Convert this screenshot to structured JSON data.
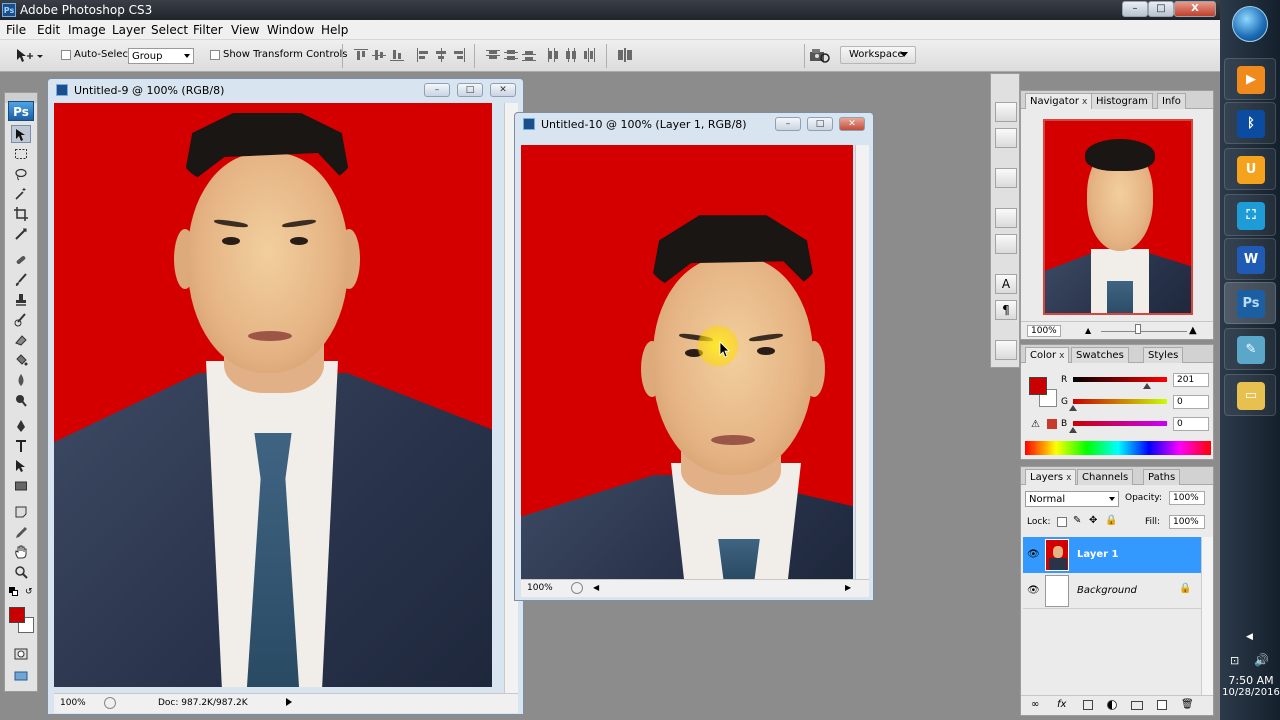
{
  "app": {
    "title": "Adobe Photoshop CS3",
    "ps_logo": "Ps",
    "window_controls": {
      "minimize": "–",
      "restore": "□",
      "close": "X"
    }
  },
  "menu": [
    "File",
    "Edit",
    "Image",
    "Layer",
    "Select",
    "Filter",
    "View",
    "Window",
    "Help"
  ],
  "options": {
    "auto_select_label": "Auto-Select:",
    "auto_select_value": "Group",
    "show_transform_label": "Show Transform Controls",
    "workspace_label": "Workspace"
  },
  "documents": [
    {
      "title": "Untitled-9 @ 100% (RGB/8)",
      "zoom": "100%",
      "doc_size": "Doc: 987.2K/987.2K"
    },
    {
      "title": "Untitled-10 @ 100% (Layer 1, RGB/8)",
      "zoom": "100%"
    }
  ],
  "navigator": {
    "tabs": [
      "Navigator",
      "Histogram",
      "Info"
    ],
    "zoom": "100%"
  },
  "color": {
    "tabs": [
      "Color",
      "Swatches",
      "Styles"
    ],
    "channels": [
      {
        "label": "R",
        "value": "201",
        "level": 0.79
      },
      {
        "label": "G",
        "value": "0",
        "level": 0
      },
      {
        "label": "B",
        "value": "0",
        "level": 0
      }
    ],
    "foreground": "#c90000",
    "background": "#ffffff"
  },
  "layers": {
    "tabs": [
      "Layers",
      "Channels",
      "Paths"
    ],
    "blend_mode": "Normal",
    "opacity_label": "Opacity:",
    "opacity": "100%",
    "lock_label": "Lock:",
    "fill_label": "Fill:",
    "fill": "100%",
    "items": [
      {
        "name": "Layer 1",
        "selected": true
      },
      {
        "name": "Background",
        "locked": true
      }
    ]
  },
  "taskbar": {
    "apps": [
      "media-player",
      "bluetooth",
      "uc-browser",
      "screen-capture",
      "word",
      "photoshop",
      "notes",
      "file-explorer"
    ],
    "time": "7:50 AM",
    "date": "10/28/2016"
  },
  "colors": {
    "canvas_red": "#d40000",
    "selection_blue": "#3399ff"
  }
}
